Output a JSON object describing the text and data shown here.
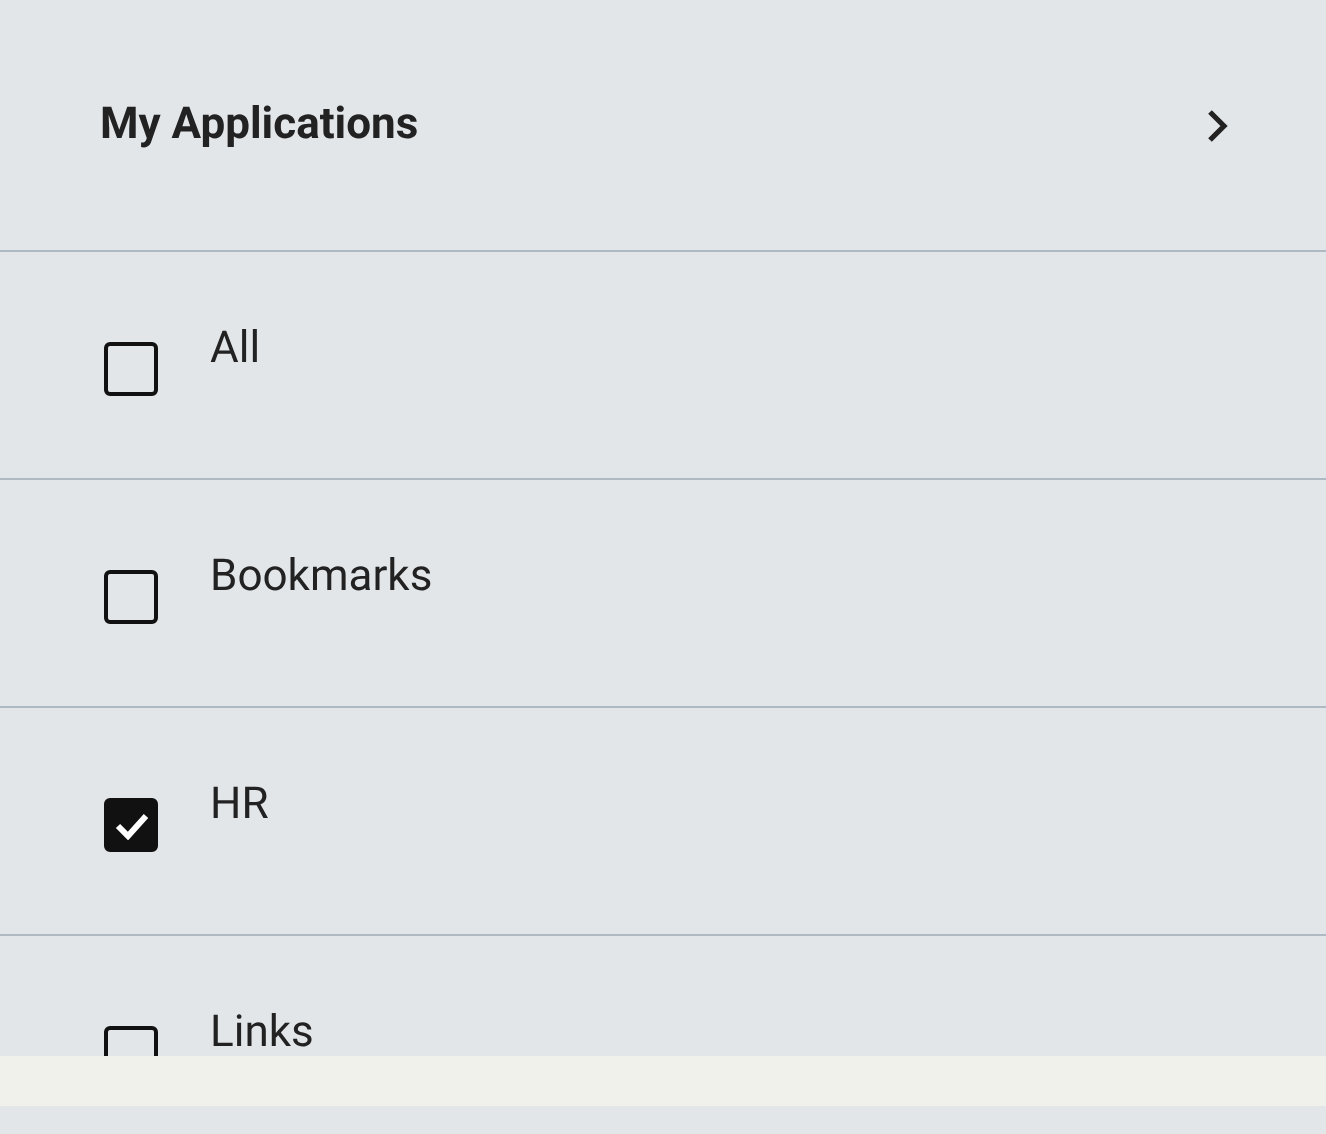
{
  "header": {
    "title": "My Applications"
  },
  "filters": [
    {
      "label": "All",
      "checked": false
    },
    {
      "label": "Bookmarks",
      "checked": false
    },
    {
      "label": "HR",
      "checked": true
    },
    {
      "label": "Links",
      "checked": false
    }
  ]
}
